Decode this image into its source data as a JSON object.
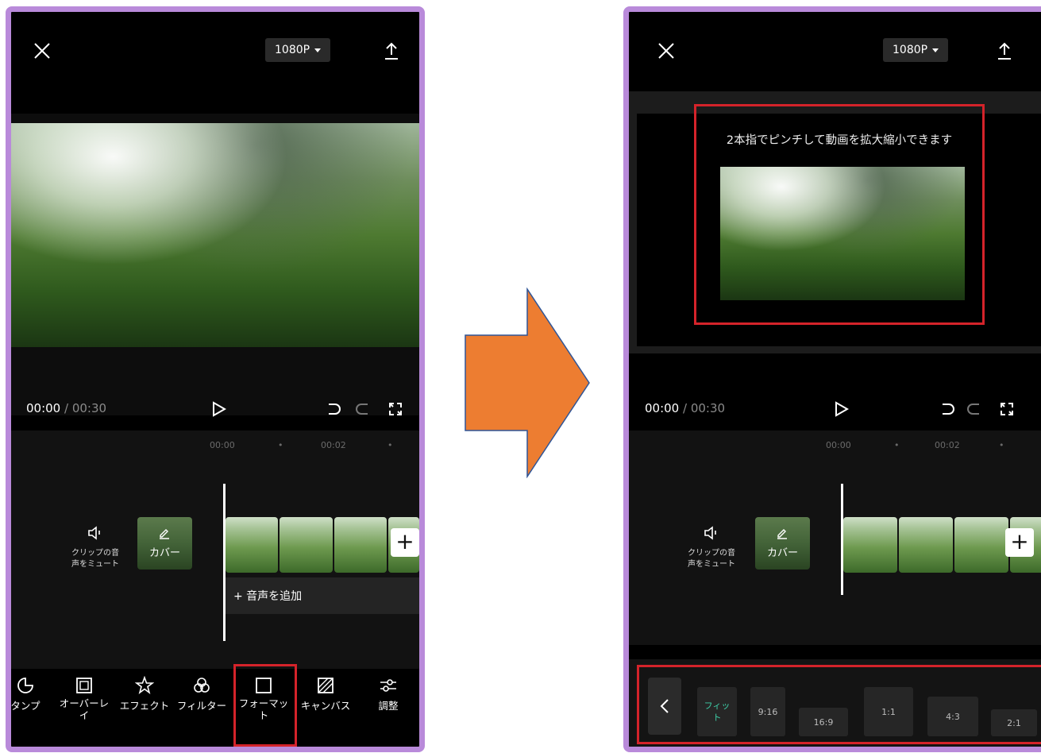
{
  "left": {
    "resolution": "1080P",
    "time_current": "00:00",
    "time_total": " / 00:30",
    "ruler": [
      "00:00",
      "•",
      "00:02",
      "•"
    ],
    "mute_label_line1": "クリップの音",
    "mute_label_line2": "声をミュート",
    "cover_label": "カバー",
    "add_audio": "+ 音声を追加",
    "toolbar": [
      {
        "label": "タンプ",
        "icon": "sticker-icon"
      },
      {
        "label": "オーバーレ\nイ",
        "icon": "overlay-icon"
      },
      {
        "label": "エフェクト",
        "icon": "effect-icon"
      },
      {
        "label": "フィルター",
        "icon": "filter-icon"
      },
      {
        "label": "フォーマッ\nト",
        "icon": "format-icon"
      },
      {
        "label": "キャンバス",
        "icon": "canvas-icon"
      },
      {
        "label": "調整",
        "icon": "adjust-icon"
      }
    ]
  },
  "right": {
    "resolution": "1080P",
    "time_current": "00:00",
    "time_total": " / 00:30",
    "ruler": [
      "00:00",
      "•",
      "00:02",
      "•"
    ],
    "hint": "2本指でピンチして動画を拡大縮小できます",
    "mute_label_line1": "クリップの音",
    "mute_label_line2": "声をミュート",
    "cover_label": "カバー",
    "ratios": [
      "フィッ\nト",
      "9:16",
      "16:9",
      "1:1",
      "4:3",
      "2:1"
    ]
  },
  "colors": {
    "frame": "#b98ada",
    "highlight": "#d4232a",
    "arrow": "#ed7d31",
    "fit_active": "#3ecfa8"
  }
}
